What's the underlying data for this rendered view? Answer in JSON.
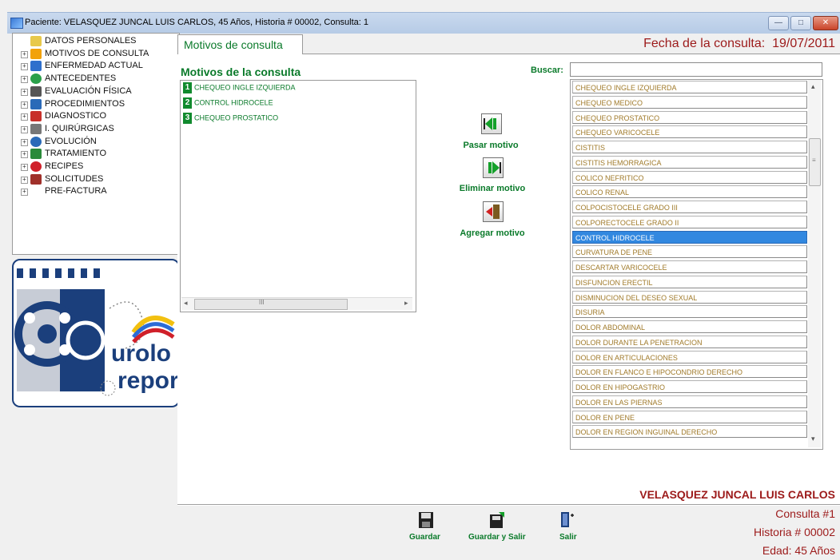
{
  "window": {
    "title": "Paciente: VELASQUEZ JUNCAL LUIS CARLOS, 45 Años, Historia # 00002, Consulta: 1",
    "minimize_label": "—",
    "restore_label": "□",
    "close_label": "✕"
  },
  "tree": {
    "items": [
      {
        "label": "DATOS PERSONALES",
        "icon": "folder-icon"
      },
      {
        "label": "MOTIVOS DE CONSULTA",
        "icon": "lightning-icon"
      },
      {
        "label": "ENFERMEDAD ACTUAL",
        "icon": "bar-chart-icon"
      },
      {
        "label": "ANTECEDENTES",
        "icon": "globe-icon"
      },
      {
        "label": "EVALUACIÓN FÍSICA",
        "icon": "person-icon"
      },
      {
        "label": "PROCEDIMIENTOS",
        "icon": "monitor-icon"
      },
      {
        "label": "DIAGNOSTICO",
        "icon": "stethoscope-icon"
      },
      {
        "label": "I. QUIRÚRGICAS",
        "icon": "grid-icon"
      },
      {
        "label": "EVOLUCIÓN",
        "icon": "info-icon"
      },
      {
        "label": "TRATAMIENTO",
        "icon": "tree-icon"
      },
      {
        "label": "RECIPES",
        "icon": "apple-icon"
      },
      {
        "label": "SOLICITUDES",
        "icon": "stack-icon"
      },
      {
        "label": "PRE-FACTURA",
        "icon": "none"
      }
    ]
  },
  "logo": {
    "line1": "urolo",
    "line2": "report"
  },
  "tab": {
    "label": "Motivos de consulta"
  },
  "fecha": {
    "label": "Fecha de la consulta:",
    "value": "19/07/2011"
  },
  "motivos": {
    "title": "Motivos de la consulta",
    "items": [
      {
        "num": "1",
        "label": "CHEQUEO INGLE IZQUIERDA"
      },
      {
        "num": "2",
        "label": "CONTROL HIDROCELE"
      },
      {
        "num": "3",
        "label": "CHEQUEO PROSTATICO"
      }
    ],
    "hscroll_glyph": "III"
  },
  "actions": {
    "pasar": "Pasar motivo",
    "eliminar": "Eliminar motivo",
    "agregar": "Agregar motivo"
  },
  "search": {
    "label": "Buscar:",
    "value": ""
  },
  "catalog": {
    "selected_index": 10,
    "items": [
      "CHEQUEO INGLE IZQUIERDA",
      "CHEQUEO MEDICO",
      "CHEQUEO PROSTATICO",
      "CHEQUEO VARICOCELE",
      "CISTITIS",
      "CISTITIS HEMORRAGICA",
      "COLICO NEFRITICO",
      "COLICO RENAL",
      "COLPOCISTOCELE GRADO III",
      "COLPORECTOCELE GRADO II",
      "CONTROL HIDROCELE",
      "CURVATURA DE PENE",
      "DESCARTAR VARICOCELE",
      "DISFUNCION ERECTIL",
      "DISMINUCION DEL DESEO SEXUAL",
      "DISURIA",
      "DOLOR ABDOMINAL",
      "DOLOR DURANTE LA PENETRACION",
      "DOLOR EN ARTICULACIONES",
      "DOLOR EN FLANCO E  HIPOCONDRIO DERECHO",
      "DOLOR EN HIPOGASTRIO",
      "DOLOR EN LAS PIERNAS",
      "DOLOR EN PENE",
      "DOLOR EN REGION INGUINAL DERECHO"
    ]
  },
  "bottom": {
    "guardar": "Guardar",
    "guardar_salir": "Guardar y Salir",
    "salir": "Salir"
  },
  "patient": {
    "name": "VELASQUEZ JUNCAL LUIS CARLOS",
    "consulta": "Consulta #1",
    "historia": "Historia # 00002",
    "edad": "Edad: 45 Años"
  },
  "colors": {
    "accent_green": "#0a7a2a",
    "accent_red": "#9c1a1a",
    "selection_blue": "#3288e0"
  }
}
